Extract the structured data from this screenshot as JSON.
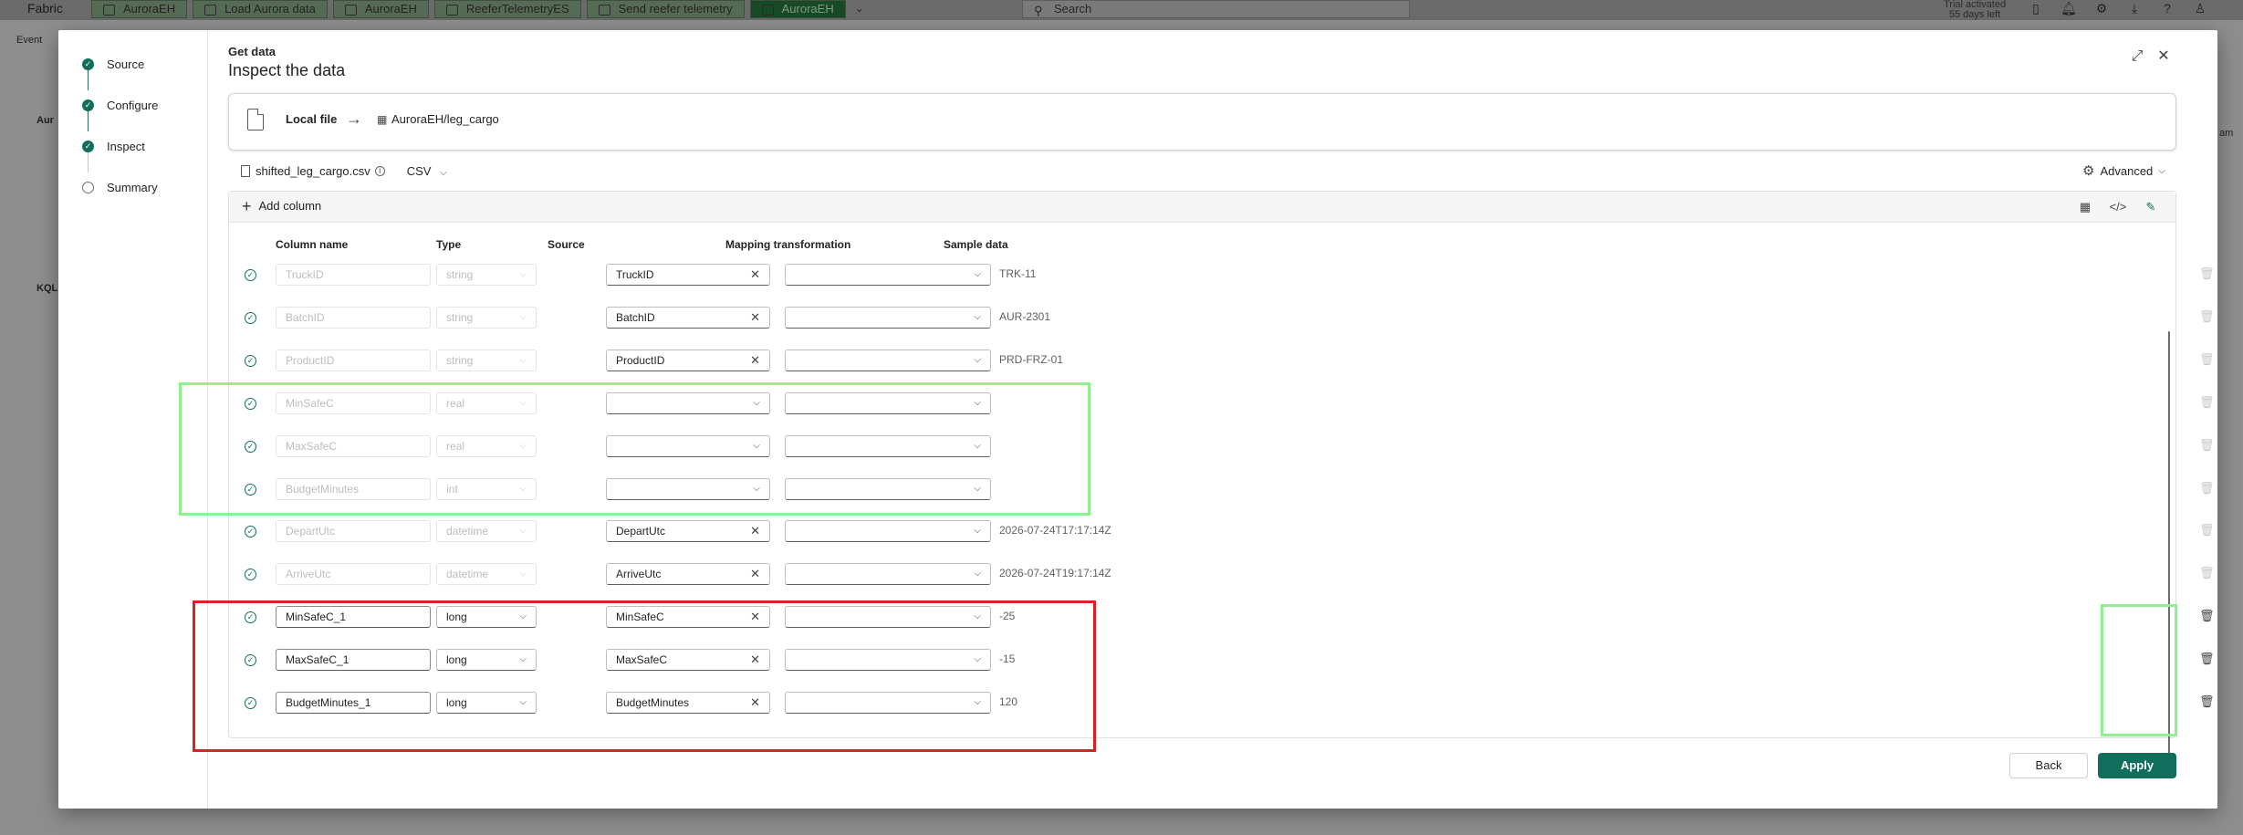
{
  "topbar": {
    "brand": "Fabric",
    "tabs": [
      {
        "label": "AuroraEH",
        "active": false
      },
      {
        "label": "Load Aurora data",
        "active": false
      },
      {
        "label": "AuroraEH",
        "active": false
      },
      {
        "label": "ReeferTelemetryES",
        "active": false
      },
      {
        "label": "Send reefer telemetry",
        "active": false
      },
      {
        "label": "AuroraEH",
        "active": true
      }
    ],
    "search_placeholder": "Search",
    "trial_line1": "Trial activated",
    "trial_line2": "55 days left"
  },
  "background": {
    "left_labels": [
      "Event",
      "Aur",
      "KQL"
    ],
    "right_label": "am"
  },
  "stepper": {
    "steps": [
      {
        "label": "Source",
        "status": "done"
      },
      {
        "label": "Configure",
        "status": "done"
      },
      {
        "label": "Inspect",
        "status": "done"
      },
      {
        "label": "Summary",
        "status": "pending"
      }
    ]
  },
  "header": {
    "overline": "Get data",
    "title": "Inspect the data"
  },
  "source_card": {
    "source": "Local file",
    "destination": "AuroraEH/leg_cargo"
  },
  "file_bar": {
    "file_name": "shifted_leg_cargo.csv",
    "format": "CSV",
    "advanced_label": "Advanced"
  },
  "table": {
    "add_column_label": "Add column",
    "headers": {
      "column_name": "Column name",
      "type": "Type",
      "source": "Source",
      "mapping": "Mapping transformation",
      "sample": "Sample data"
    },
    "rows": [
      {
        "name": "TruckID",
        "type": "string",
        "source": "TruckID",
        "sample": "TRK-11",
        "editable": false
      },
      {
        "name": "BatchID",
        "type": "string",
        "source": "BatchID",
        "sample": "AUR-2301",
        "editable": false
      },
      {
        "name": "ProductID",
        "type": "string",
        "source": "ProductID",
        "sample": "PRD-FRZ-01",
        "editable": false
      },
      {
        "name": "MinSafeC",
        "type": "real",
        "source": "",
        "sample": "",
        "editable": false
      },
      {
        "name": "MaxSafeC",
        "type": "real",
        "source": "",
        "sample": "",
        "editable": false
      },
      {
        "name": "BudgetMinutes",
        "type": "int",
        "source": "",
        "sample": "",
        "editable": false
      },
      {
        "name": "DepartUtc",
        "type": "datetime",
        "source": "DepartUtc",
        "sample": "2026-07-24T17:17:14Z",
        "editable": false
      },
      {
        "name": "ArriveUtc",
        "type": "datetime",
        "source": "ArriveUtc",
        "sample": "2026-07-24T19:17:14Z",
        "editable": false
      },
      {
        "name": "MinSafeC_1",
        "type": "long",
        "source": "MinSafeC",
        "sample": "-25",
        "editable": true
      },
      {
        "name": "MaxSafeC_1",
        "type": "long",
        "source": "MaxSafeC",
        "sample": "-15",
        "editable": true
      },
      {
        "name": "BudgetMinutes_1",
        "type": "long",
        "source": "BudgetMinutes",
        "sample": "120",
        "editable": true
      }
    ]
  },
  "footer": {
    "back_label": "Back",
    "apply_label": "Apply"
  },
  "colors": {
    "accent": "#116d5c",
    "highlight_green": "#8ef08e",
    "highlight_red": "#e02020"
  }
}
